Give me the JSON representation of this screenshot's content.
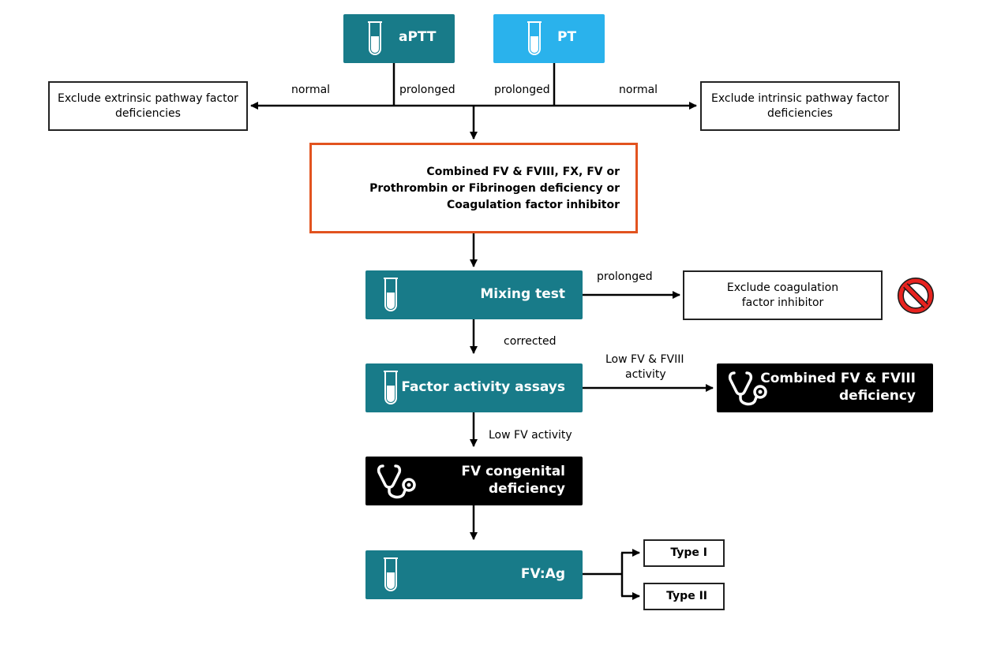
{
  "colors": {
    "teal": "#187b89",
    "sky_blue": "#2ab2ec",
    "orange_border": "#e2531f",
    "black": "#000000",
    "prohibited_red": "#e8231f"
  },
  "nodes": {
    "aptt": {
      "label": "aPTT",
      "icon": "test-tube-icon"
    },
    "pt": {
      "label": "PT",
      "icon": "test-tube-icon"
    },
    "exclude_extrinsic": {
      "line1": "Exclude extrinsic pathway factor",
      "line2": "deficiencies"
    },
    "exclude_intrinsic": {
      "line1": "Exclude intrinsic pathway factor",
      "line2": "deficiencies"
    },
    "differential": {
      "line1": "Combined FV & FVIII, FX, FV or",
      "line2": "Prothrombin or Fibrinogen deficiency or",
      "line3": "Coagulation factor inhibitor"
    },
    "mixing_test": {
      "label": "Mixing test",
      "icon": "test-tube-icon"
    },
    "exclude_inhibitor": {
      "line1": "Exclude coagulation",
      "line2": "factor inhibitor",
      "icon": "prohibited-icon"
    },
    "factor_assays": {
      "label": "Factor activity assays",
      "icon": "test-tube-icon"
    },
    "combined_deficiency": {
      "line1": "Combined FV & FVIII",
      "line2": "deficiency",
      "icon": "stethoscope-icon"
    },
    "fv_congenital": {
      "line1": "FV congenital",
      "line2": "deficiency",
      "icon": "stethoscope-icon"
    },
    "fv_ag": {
      "label": "FV:Ag",
      "icon": "test-tube-icon"
    },
    "type1": {
      "label": "Type I"
    },
    "type2": {
      "label": "Type II"
    }
  },
  "edge_labels": {
    "aptt_normal": "normal",
    "aptt_prolonged": "prolonged",
    "pt_prolonged": "prolonged",
    "pt_normal": "normal",
    "mixing_prolonged": "prolonged",
    "mixing_corrected": "corrected",
    "assay_low_fv_fviii_1": "Low FV & FVIII",
    "assay_low_fv_fviii_2": "activity",
    "assay_low_fv": "Low FV activity"
  }
}
